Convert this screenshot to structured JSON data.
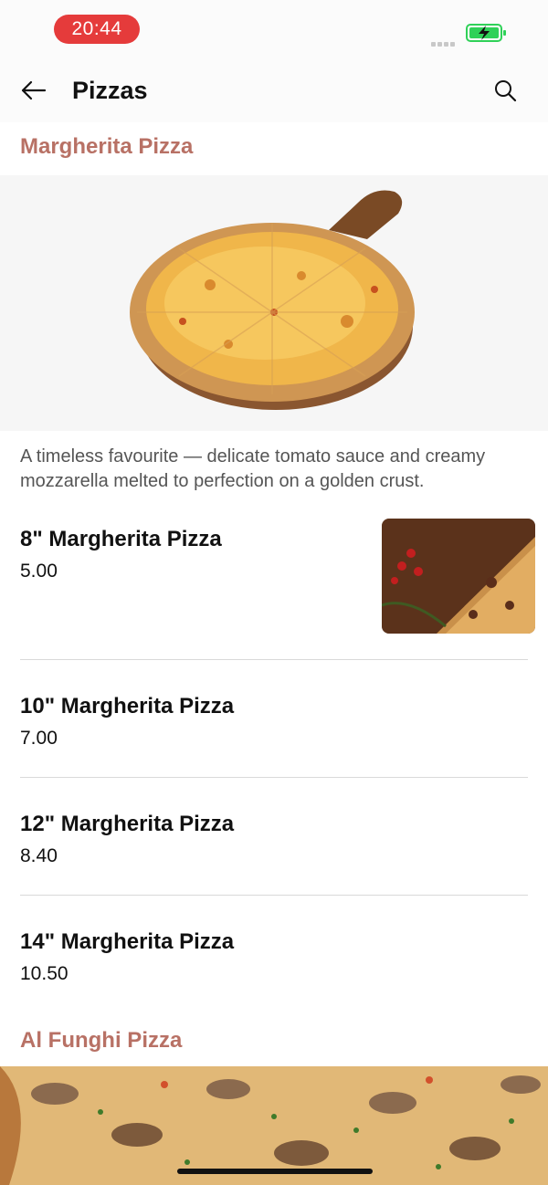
{
  "status": {
    "time": "20:44",
    "time_pill_color": "#e53b3b",
    "battery_color": "#2fd158",
    "battery_icon": "battery-charging-icon"
  },
  "appbar": {
    "title": "Pizzas",
    "back_icon": "arrow-left-icon",
    "search_icon": "search-icon"
  },
  "accent_color": "#b87165",
  "sections": [
    {
      "title": "Margherita Pizza",
      "description": "A timeless favourite — delicate tomato sauce and creamy mozzarella melted to perfection on a golden crust.",
      "items": [
        {
          "name": "8\" Margherita Pizza",
          "price": "5.00"
        },
        {
          "name": "10\" Margherita Pizza",
          "price": "7.00"
        },
        {
          "name": "12\" Margherita Pizza",
          "price": "8.40"
        },
        {
          "name": "14\" Margherita Pizza",
          "price": "10.50"
        }
      ]
    },
    {
      "title": "Al Funghi Pizza"
    }
  ]
}
